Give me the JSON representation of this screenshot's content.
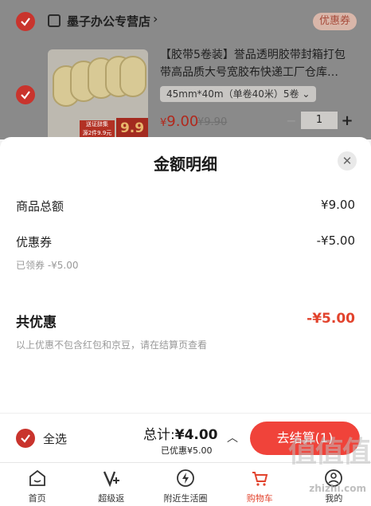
{
  "store": {
    "name": "墨子办公专营店",
    "chevron": "›",
    "coupon_label": "优惠券"
  },
  "product": {
    "title": "【胶带5卷装】誉品透明胶带封箱打包\n带高品质大号宽胶布快递工厂仓库…",
    "spec": "45mm*40m（单卷40米）5卷 ⌄",
    "price_symbol": "¥",
    "price": "9.00",
    "original_price": "¥9.90",
    "quantity": "1",
    "minus": "−",
    "plus": "+",
    "thumb_badge": "送证辞集\n源2件9.9元",
    "thumb_price": "9.9"
  },
  "sheet": {
    "title": "金额明细",
    "close": "✕",
    "goods_total_label": "商品总额",
    "goods_total_value": "¥9.00",
    "coupon_label": "优惠券",
    "coupon_value": "-¥5.00",
    "coupon_note": "已领券 -¥5.00",
    "total_discount_label": "共优惠",
    "total_discount_value": "-¥5.00",
    "disclaimer": "以上优惠不包含红包和京豆，请在结算页查看"
  },
  "checkout": {
    "select_all": "全选",
    "total_prefix": "总计:",
    "total_value": "¥4.00",
    "saving": "已优惠¥5.00",
    "caret": "︿",
    "button": "去结算(1)"
  },
  "tabs": [
    {
      "label": "首页",
      "icon": "home-icon"
    },
    {
      "label": "超级返",
      "icon": "cashback-icon"
    },
    {
      "label": "附近生活圈",
      "icon": "lightning-icon"
    },
    {
      "label": "购物车",
      "icon": "cart-icon"
    },
    {
      "label": "我的",
      "icon": "profile-icon"
    }
  ],
  "watermark": {
    "text": "值值值",
    "sub": "zhizhi.com"
  },
  "colors": {
    "accent": "#e2432d",
    "check": "#c9342d",
    "button": "#f0433a"
  }
}
